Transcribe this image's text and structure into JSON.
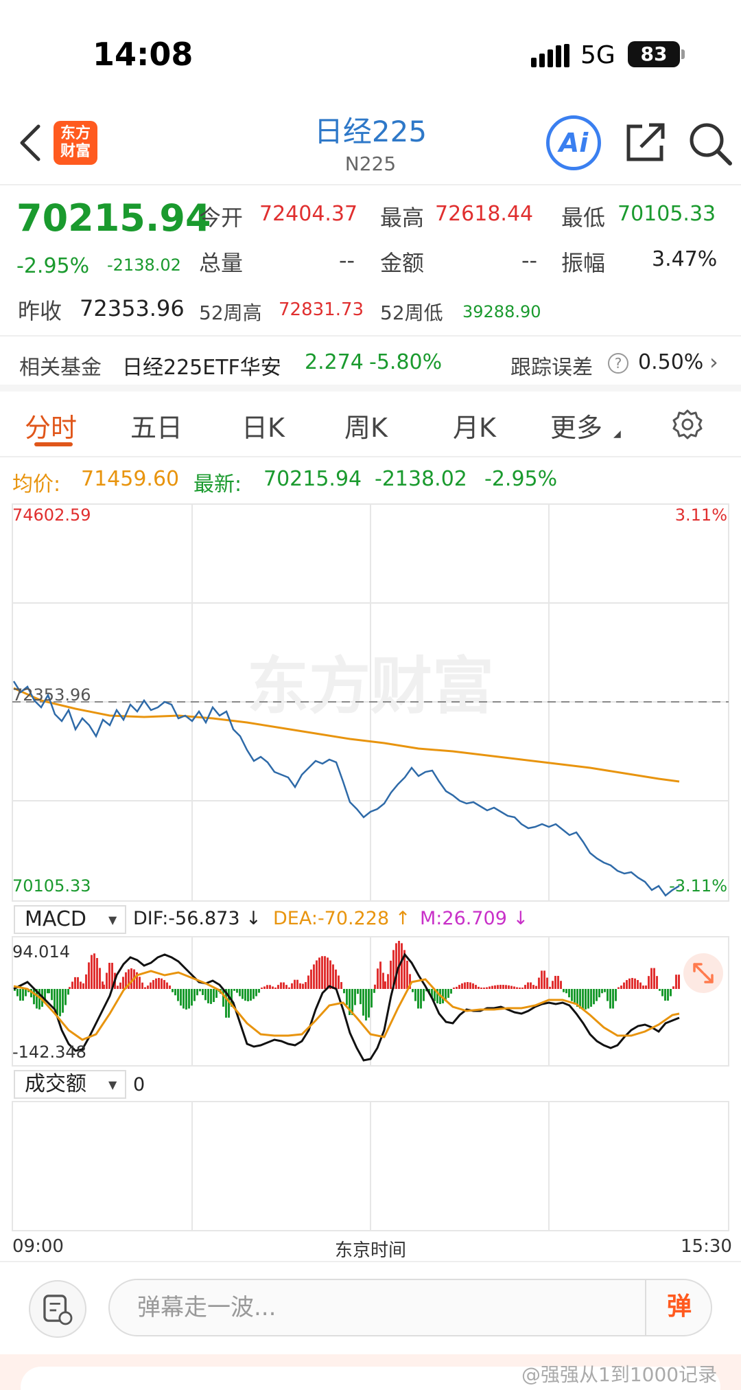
{
  "status": {
    "time": "14:08",
    "network": "5G",
    "battery": "83"
  },
  "header": {
    "title": "日经225",
    "subtitle": "N225",
    "logo": "东方财富",
    "ai": "Ai"
  },
  "quote": {
    "price": "70215.94",
    "change_pct": "-2.95%",
    "change_amt": "-2138.02",
    "open_label": "今开",
    "open": "72404.37",
    "high_label": "最高",
    "high": "72618.44",
    "low_label": "最低",
    "low": "70105.33",
    "volume_label": "总量",
    "volume": "--",
    "amount_label": "金额",
    "amount": "--",
    "amplitude_label": "振幅",
    "amplitude": "3.47%",
    "prev_close_label": "昨收",
    "prev_close": "72353.96",
    "w52_high_label": "52周高",
    "w52_high": "72831.73",
    "w52_low_label": "52周低",
    "w52_low": "39288.90"
  },
  "fund": {
    "label": "相关基金",
    "name": "日经225ETF华安",
    "price": "2.274",
    "pct": "-5.80%",
    "tracking_label": "跟踪误差",
    "tracking": "0.50%"
  },
  "tabs": [
    "分时",
    "五日",
    "日K",
    "周K",
    "月K",
    "更多"
  ],
  "info": {
    "avg_label": "均价:",
    "avg": "71459.60",
    "latest_label": "最新:",
    "latest": "70215.94",
    "latest_chg": "-2138.02",
    "latest_pct": "-2.95%"
  },
  "chart": {
    "y_max": "74602.59",
    "y_max_pct": "3.11%",
    "y_ref": "72353.96",
    "y_min": "70105.33",
    "y_min_pct": "-3.11%",
    "watermark": "东方财富"
  },
  "macd": {
    "label": "MACD",
    "dif": "DIF:-56.873 ↓",
    "dea": "DEA:-70.228 ↑",
    "m": "M:26.709 ↓",
    "top": "94.014",
    "bottom": "-142.348"
  },
  "volume": {
    "label": "成交额",
    "value": "0"
  },
  "time_axis": {
    "start": "09:00",
    "mid": "东京时间",
    "end": "15:30"
  },
  "comment": {
    "placeholder": "弹幕走一波...",
    "send": "弹"
  },
  "footer": {
    "watermark": "@强强从1到1000记录"
  },
  "colors": {
    "up": "#e02f2f",
    "down": "#1a9a2e",
    "avg_line": "#e8940e",
    "price_line": "#2e6aa8",
    "accent": "#ff5a1f"
  }
}
